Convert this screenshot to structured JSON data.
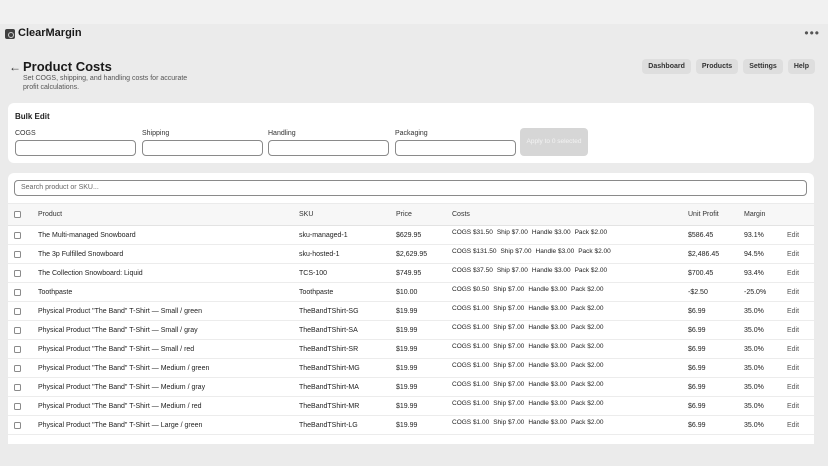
{
  "app": {
    "title": "ClearMargin",
    "more_icon": "ellipsis-icon"
  },
  "header": {
    "title": "Product Costs",
    "subtitle": "Set COGS, shipping, and handling costs for accurate profit calculations.",
    "nav": [
      "Dashboard",
      "Products",
      "Settings",
      "Help"
    ]
  },
  "bulk": {
    "title": "Bulk Edit",
    "fields": [
      "COGS",
      "Shipping",
      "Handling",
      "Packaging"
    ],
    "apply_label": "Apply to 0 selected"
  },
  "search": {
    "placeholder": "Search product or SKU..."
  },
  "table": {
    "columns": [
      "Product",
      "SKU",
      "Price",
      "Costs",
      "Unit Profit",
      "Margin"
    ],
    "edit_label": "Edit",
    "rows": [
      {
        "product": "The Multi-managed Snowboard",
        "sku": "sku-managed-1",
        "price": "$629.95",
        "cogs": "COGS $31.50",
        "ship": "Ship $7.00",
        "handle": "Handle $3.00",
        "pack": "Pack $2.00",
        "profit": "$586.45",
        "margin": "93.1%"
      },
      {
        "product": "The 3p Fulfilled Snowboard",
        "sku": "sku-hosted-1",
        "price": "$2,629.95",
        "cogs": "COGS $131.50",
        "ship": "Ship $7.00",
        "handle": "Handle $3.00",
        "pack": "Pack $2.00",
        "profit": "$2,486.45",
        "margin": "94.5%"
      },
      {
        "product": "The Collection Snowboard: Liquid",
        "sku": "TCS-100",
        "price": "$749.95",
        "cogs": "COGS $37.50",
        "ship": "Ship $7.00",
        "handle": "Handle $3.00",
        "pack": "Pack $2.00",
        "profit": "$700.45",
        "margin": "93.4%"
      },
      {
        "product": "Toothpaste",
        "sku": "Toothpaste",
        "price": "$10.00",
        "cogs": "COGS $0.50",
        "ship": "Ship $7.00",
        "handle": "Handle $3.00",
        "pack": "Pack $2.00",
        "profit": "-$2.50",
        "margin": "-25.0%"
      },
      {
        "product": "Physical Product \"The Band\" T-Shirt — Small / green",
        "sku": "TheBandTShirt-SG",
        "price": "$19.99",
        "cogs": "COGS $1.00",
        "ship": "Ship $7.00",
        "handle": "Handle $3.00",
        "pack": "Pack $2.00",
        "profit": "$6.99",
        "margin": "35.0%"
      },
      {
        "product": "Physical Product \"The Band\" T-Shirt — Small / gray",
        "sku": "TheBandTShirt-SA",
        "price": "$19.99",
        "cogs": "COGS $1.00",
        "ship": "Ship $7.00",
        "handle": "Handle $3.00",
        "pack": "Pack $2.00",
        "profit": "$6.99",
        "margin": "35.0%"
      },
      {
        "product": "Physical Product \"The Band\" T-Shirt — Small / red",
        "sku": "TheBandTShirt-SR",
        "price": "$19.99",
        "cogs": "COGS $1.00",
        "ship": "Ship $7.00",
        "handle": "Handle $3.00",
        "pack": "Pack $2.00",
        "profit": "$6.99",
        "margin": "35.0%"
      },
      {
        "product": "Physical Product \"The Band\" T-Shirt — Medium / green",
        "sku": "TheBandTShirt-MG",
        "price": "$19.99",
        "cogs": "COGS $1.00",
        "ship": "Ship $7.00",
        "handle": "Handle $3.00",
        "pack": "Pack $2.00",
        "profit": "$6.99",
        "margin": "35.0%"
      },
      {
        "product": "Physical Product \"The Band\" T-Shirt — Medium / gray",
        "sku": "TheBandTShirt-MA",
        "price": "$19.99",
        "cogs": "COGS $1.00",
        "ship": "Ship $7.00",
        "handle": "Handle $3.00",
        "pack": "Pack $2.00",
        "profit": "$6.99",
        "margin": "35.0%"
      },
      {
        "product": "Physical Product \"The Band\" T-Shirt — Medium / red",
        "sku": "TheBandTShirt-MR",
        "price": "$19.99",
        "cogs": "COGS $1.00",
        "ship": "Ship $7.00",
        "handle": "Handle $3.00",
        "pack": "Pack $2.00",
        "profit": "$6.99",
        "margin": "35.0%"
      },
      {
        "product": "Physical Product \"The Band\" T-Shirt — Large / green",
        "sku": "TheBandTShirt-LG",
        "price": "$19.99",
        "cogs": "COGS $1.00",
        "ship": "Ship $7.00",
        "handle": "Handle $3.00",
        "pack": "Pack $2.00",
        "profit": "$6.99",
        "margin": "35.0%"
      }
    ]
  }
}
